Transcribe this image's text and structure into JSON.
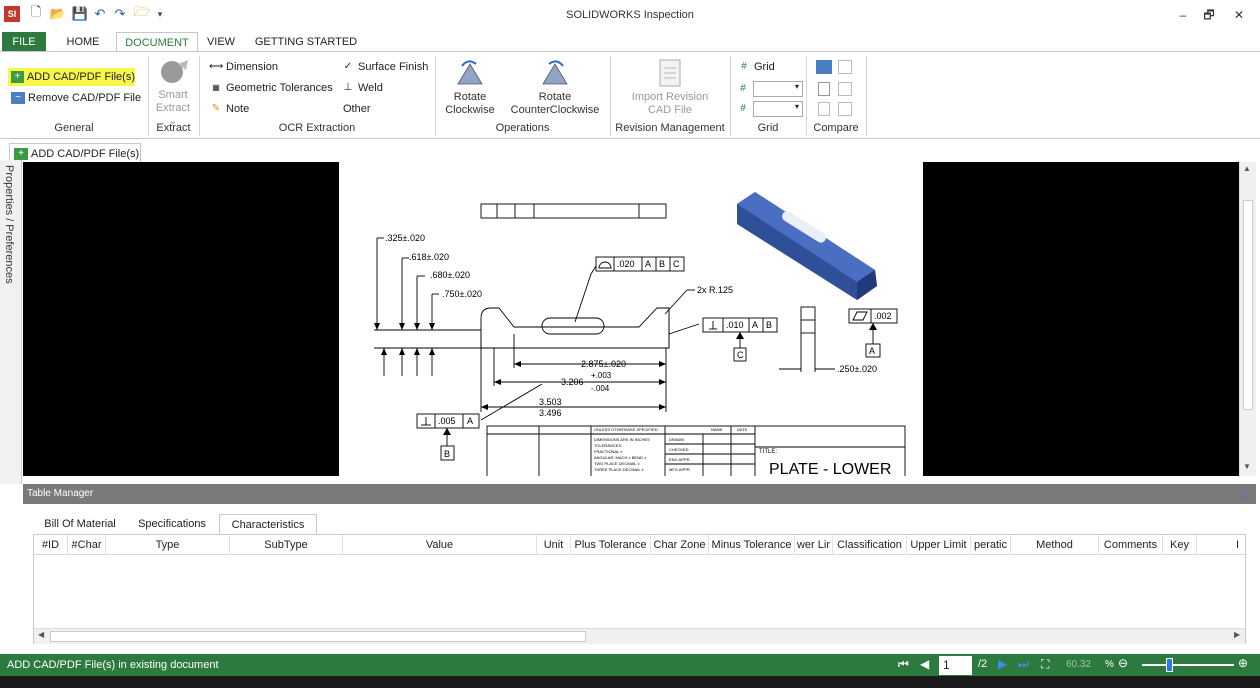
{
  "app": {
    "title": "SOLIDWORKS Inspection"
  },
  "window": {
    "minimize": "–",
    "restore": "🗗",
    "close": "✕"
  },
  "ribbon_tabs": [
    {
      "label": "FILE"
    },
    {
      "label": "HOME"
    },
    {
      "label": "DOCUMENT"
    },
    {
      "label": "VIEW"
    },
    {
      "label": "GETTING STARTED"
    }
  ],
  "ribbon": {
    "general": {
      "label": "General",
      "add": "ADD CAD/PDF File(s)",
      "remove": "Remove CAD/PDF File"
    },
    "extract": {
      "label": "Extract",
      "smart_line1": "Smart",
      "smart_line2": "Extract ⌄"
    },
    "ocr": {
      "label": "OCR Extraction",
      "dimension": "Dimension",
      "geometric": "Geometric Tolerances",
      "note": "Note",
      "surface": "Surface Finish",
      "weld": "Weld",
      "other": "Other"
    },
    "operations": {
      "label": "Operations",
      "rotate_cw_1": "Rotate",
      "rotate_cw_2": "Clockwise",
      "rotate_ccw_1": "Rotate",
      "rotate_ccw_2": "CounterClockwise"
    },
    "revision": {
      "label": "Revision Management",
      "import_1": "Import Revision",
      "import_2": "CAD File"
    },
    "grid": {
      "label": "Grid",
      "grid": "Grid"
    },
    "compare": {
      "label": "Compare"
    }
  },
  "doc_tab": {
    "label": "ADD CAD/PDF File(s)"
  },
  "side_panel": {
    "label": "Properties / Preferences"
  },
  "drawing": {
    "dims": [
      ".325±.020",
      ".618±.020",
      ".680±.020",
      ".750±.020",
      "2x R.125",
      "2.875±.020",
      "3.206",
      "+.003",
      "-.004",
      "3.503",
      "3.496",
      ".250±.020"
    ],
    "fcf1": [
      ".020",
      "A",
      "B",
      "C"
    ],
    "fcf2": [
      ".010",
      "A",
      "B"
    ],
    "fcf3": [
      ".005",
      "A"
    ],
    "fcf4": [
      ".002"
    ],
    "datums": [
      "A",
      "B",
      "C"
    ],
    "title_block": {
      "unless": "UNLESS OTHERWISE SPECIFIED:",
      "name": "NAME",
      "date": "DATE",
      "dims_in": "DIMENSIONS ARE IN INCHES",
      "tol": "TOLERANCES:",
      "frac": "FRACTIONAL ±",
      "ang": "ANGULAR: MACH ±   BEND ±",
      "two": "TWO PLACE DECIMAL   ±",
      "three": "THREE PLACE DECIMAL  ±",
      "drawn": "DRAWN",
      "checked": "CHECKED",
      "eng": "ENG APPR.",
      "mfg": "MFG APPR.",
      "title_lbl": "TITLE:",
      "title": "PLATE - LOWER"
    }
  },
  "table_manager": {
    "title": "Table Manager",
    "tabs": [
      "Bill Of Material",
      "Specifications",
      "Characteristics"
    ],
    "columns": [
      "#ID",
      "#Char",
      "Type",
      "SubType",
      "Value",
      "Unit",
      "Plus Tolerance",
      "Char Zone",
      "Minus Tolerance",
      "wer Lir",
      "Classification",
      "Upper Limit",
      "peratic",
      "Method",
      "Comments",
      "Key",
      "I"
    ]
  },
  "status": {
    "text": "ADD CAD/PDF File(s) in existing document",
    "page": "1",
    "page_total": "/2",
    "zoom": "60.32",
    "zoom_unit": "%"
  },
  "colors": {
    "brand_green": "#2d7a3f",
    "highlight": "#f6f74a",
    "part_blue": "#3a5fae"
  }
}
